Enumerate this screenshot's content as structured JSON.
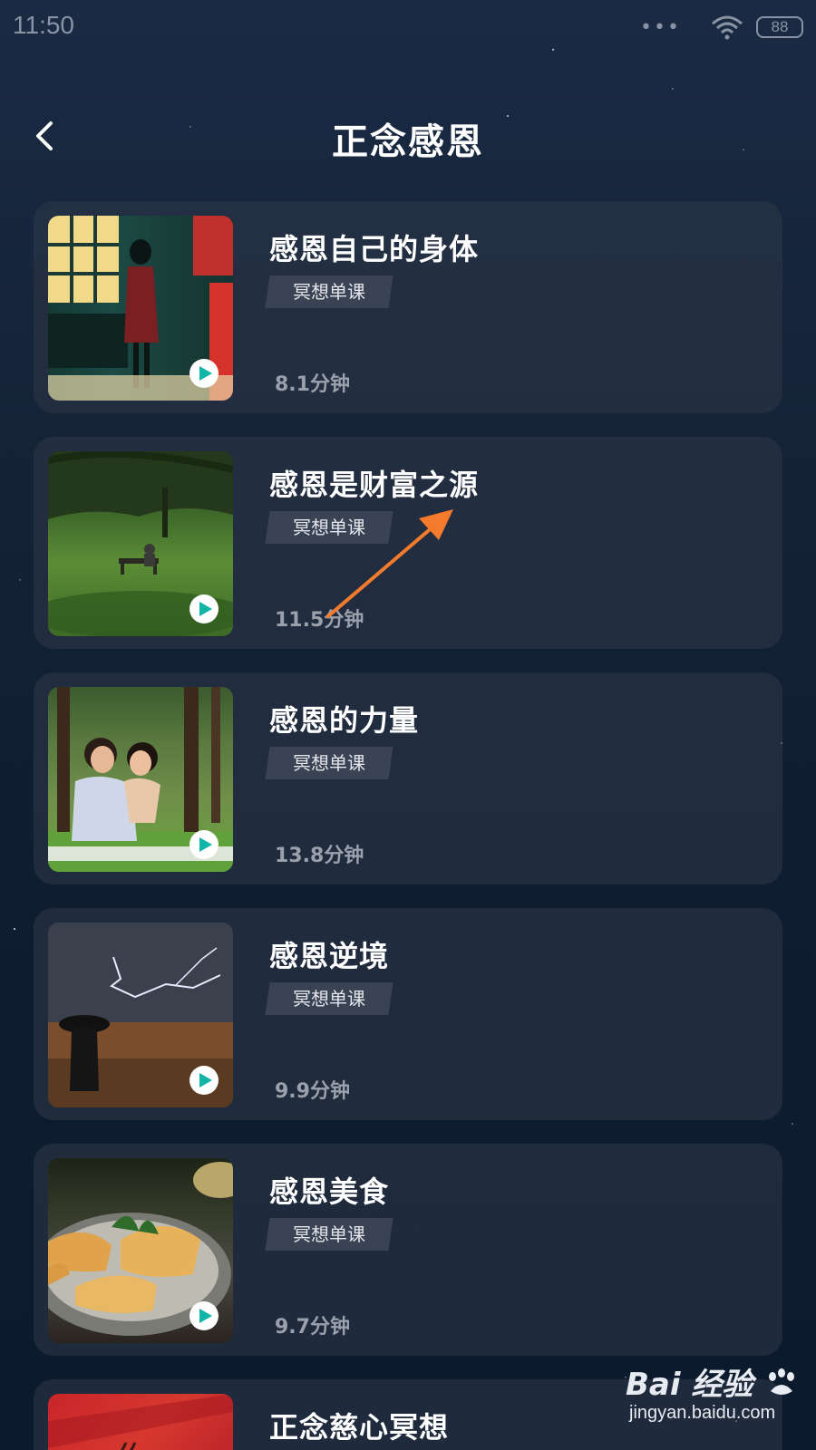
{
  "status_bar": {
    "time": "11:50",
    "dots": "•••",
    "battery": "88"
  },
  "header": {
    "title": "正念感恩"
  },
  "courses": [
    {
      "title": "感恩自己的身体",
      "tag": "冥想单课",
      "duration": "8.1分钟"
    },
    {
      "title": "感恩是财富之源",
      "tag": "冥想单课",
      "duration": "11.5分钟"
    },
    {
      "title": "感恩的力量",
      "tag": "冥想单课",
      "duration": "13.8分钟"
    },
    {
      "title": "感恩逆境",
      "tag": "冥想单课",
      "duration": "9.9分钟"
    },
    {
      "title": "感恩美食",
      "tag": "冥想单课",
      "duration": "9.7分钟"
    },
    {
      "title": "正念慈心冥想"
    }
  ],
  "watermark": {
    "brand": "Bai 经验",
    "url": "jingyan.baidu.com"
  },
  "colors": {
    "background": "#142338",
    "card": "#2c3546",
    "tag": "#3a4353",
    "play_icon": "#12b5a6",
    "annotation_arrow": "#f47a2c"
  }
}
